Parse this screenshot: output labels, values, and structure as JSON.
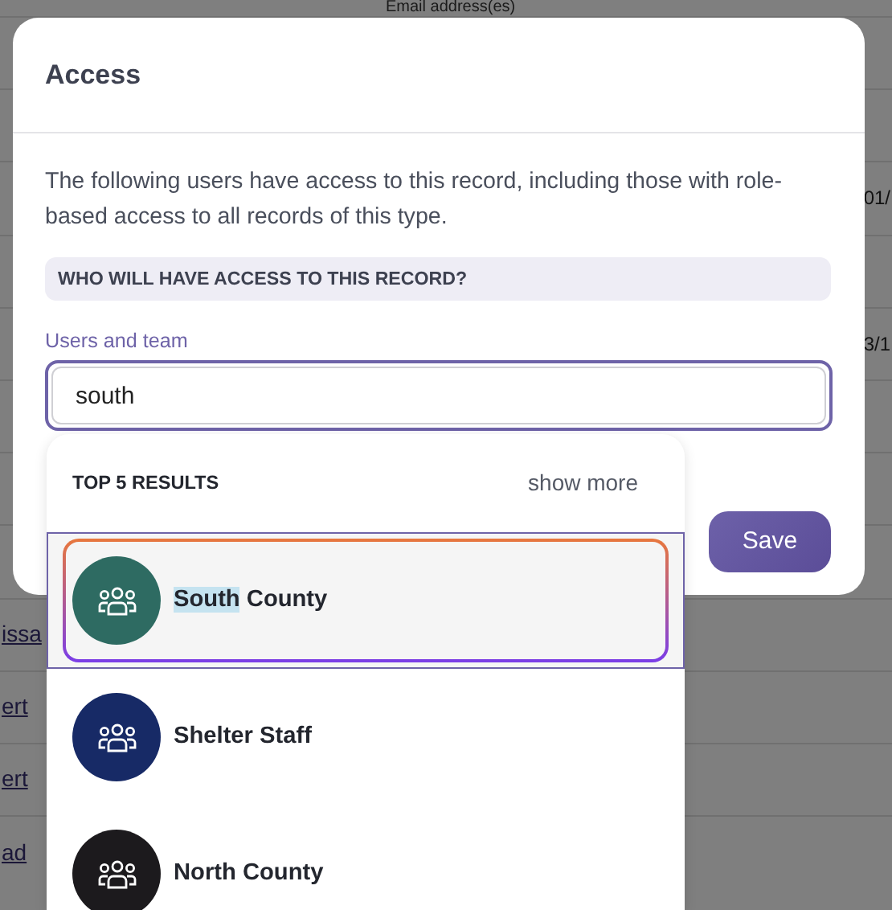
{
  "background_table": {
    "header": "Email address(es)",
    "rows": [
      {},
      {},
      {
        "column_2": "01/"
      },
      {},
      {
        "column_2": "3/1"
      },
      {},
      {},
      {},
      {
        "column_1": "issa"
      },
      {
        "column_1": "ert"
      },
      {
        "column_1": "ert"
      },
      {
        "column_1": "ad"
      }
    ]
  },
  "dialog": {
    "title": "Access",
    "description": "The following users have access to this record, including those with role-based access to all records of this type.",
    "section_heading": "WHO WILL HAVE ACCESS TO THIS RECORD?",
    "field": {
      "label": "Users and team",
      "value": "south"
    },
    "save_button": "Save"
  },
  "results": {
    "heading": "TOP 5 RESULTS",
    "show_more": "show more",
    "items": [
      {
        "match": "South",
        "rest": " County",
        "color": "#2e6b62",
        "selected": true
      },
      {
        "name": "Shelter Staff",
        "color": "#172a66",
        "selected": false
      },
      {
        "name": "North County",
        "color": "#1c1a1d",
        "selected": false
      }
    ]
  }
}
